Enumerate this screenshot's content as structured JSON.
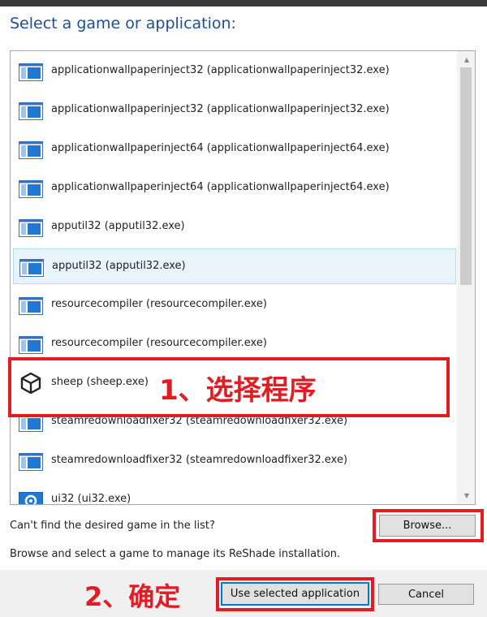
{
  "dialog": {
    "heading": "Select a game or application:"
  },
  "list": {
    "items": [
      {
        "label": "applicationwallpaperinject32 (applicationwallpaperinject32.exe)",
        "icon": "app-window-icon",
        "selected": false
      },
      {
        "label": "applicationwallpaperinject32 (applicationwallpaperinject32.exe)",
        "icon": "app-window-icon",
        "selected": false
      },
      {
        "label": "applicationwallpaperinject64 (applicationwallpaperinject64.exe)",
        "icon": "app-window-icon",
        "selected": false
      },
      {
        "label": "applicationwallpaperinject64 (applicationwallpaperinject64.exe)",
        "icon": "app-window-icon",
        "selected": false
      },
      {
        "label": "apputil32 (apputil32.exe)",
        "icon": "app-window-icon",
        "selected": false
      },
      {
        "label": "apputil32 (apputil32.exe)",
        "icon": "app-window-icon",
        "selected": true
      },
      {
        "label": "resourcecompiler (resourcecompiler.exe)",
        "icon": "app-window-icon",
        "selected": false
      },
      {
        "label": "resourcecompiler (resourcecompiler.exe)",
        "icon": "app-window-icon",
        "selected": false
      },
      {
        "label": "sheep (sheep.exe)",
        "icon": "unity-logo-icon",
        "selected": false
      },
      {
        "label": "steamredownloadfixer32 (steamredownloadfixer32.exe)",
        "icon": "app-window-icon",
        "selected": false
      },
      {
        "label": "steamredownloadfixer32 (steamredownloadfixer32.exe)",
        "icon": "app-window-icon",
        "selected": false
      },
      {
        "label": "ui32 (ui32.exe)",
        "icon": "gear-app-icon",
        "selected": false
      }
    ]
  },
  "annotations": {
    "step1": "1、选择程序",
    "step2": "2、确定",
    "color": "#e31b23"
  },
  "browse": {
    "prompt": "Can't find the desired game in the list?",
    "button_label": "Browse...",
    "description": "Browse and select a game to manage its ReShade installation."
  },
  "footer": {
    "use_label": "Use selected application",
    "cancel_label": "Cancel"
  },
  "colors": {
    "heading": "#1b4f9c",
    "selection_bg": "#e8f3fb",
    "focus_border": "#0078d7"
  }
}
